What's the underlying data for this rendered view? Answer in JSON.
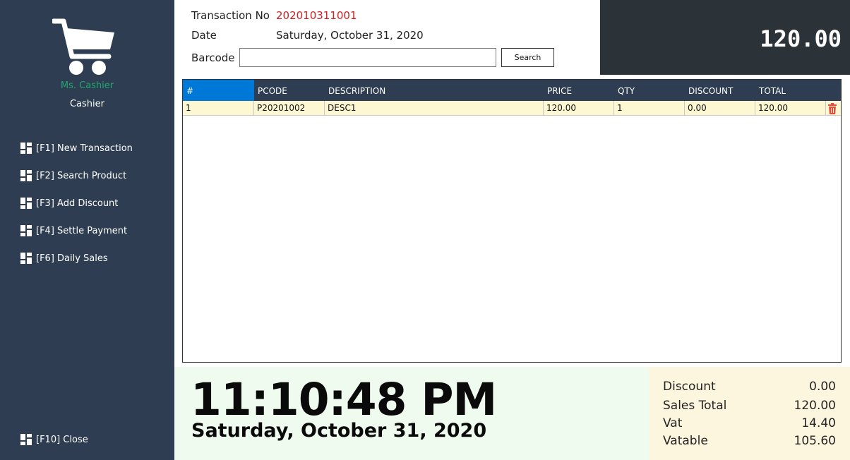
{
  "sidebar": {
    "user_name": "Ms. Cashier",
    "user_role": "Cashier",
    "menu": [
      {
        "label": "[F1] New Transaction",
        "icon": "dashboard-tile-icon"
      },
      {
        "label": "[F2] Search Product",
        "icon": "dashboard-tile-icon"
      },
      {
        "label": "[F3] Add Discount",
        "icon": "dashboard-tile-icon"
      },
      {
        "label": "[F4] Settle Payment",
        "icon": "dashboard-tile-icon"
      },
      {
        "label": "[F6] Daily Sales",
        "icon": "dashboard-tile-icon"
      }
    ],
    "close_label": "[F10] Close"
  },
  "header": {
    "transaction_label": "Transaction No",
    "transaction_value": "202010311001",
    "date_label": "Date",
    "date_value": "Saturday, October 31, 2020",
    "barcode_label": "Barcode",
    "barcode_value": "",
    "search_label": "Search"
  },
  "total_display": "120.00",
  "table": {
    "columns": [
      "#",
      "PCODE",
      "DESCRIPTION",
      "PRICE",
      "QTY",
      "DISCOUNT",
      "TOTAL"
    ],
    "rows": [
      {
        "no": "1",
        "pcode": "P20201002",
        "description": "DESC1",
        "price": "120.00",
        "qty": "1",
        "discount": "0.00",
        "total": "120.00"
      }
    ]
  },
  "clock": {
    "time": "11:10:48 PM",
    "date": "Saturday, October 31, 2020"
  },
  "summary": {
    "discount_label": "Discount",
    "discount_value": "0.00",
    "sales_total_label": "Sales Total",
    "sales_total_value": "120.00",
    "vat_label": "Vat",
    "vat_value": "14.40",
    "vatable_label": "Vatable",
    "vatable_value": "105.60"
  },
  "colors": {
    "sidebar_bg": "#2e3d51",
    "accent_blue": "#0078d7",
    "transaction_red": "#d32020",
    "user_green": "#20a870",
    "row_highlight": "#fdf8d2",
    "trash_red": "#e74c3c"
  }
}
